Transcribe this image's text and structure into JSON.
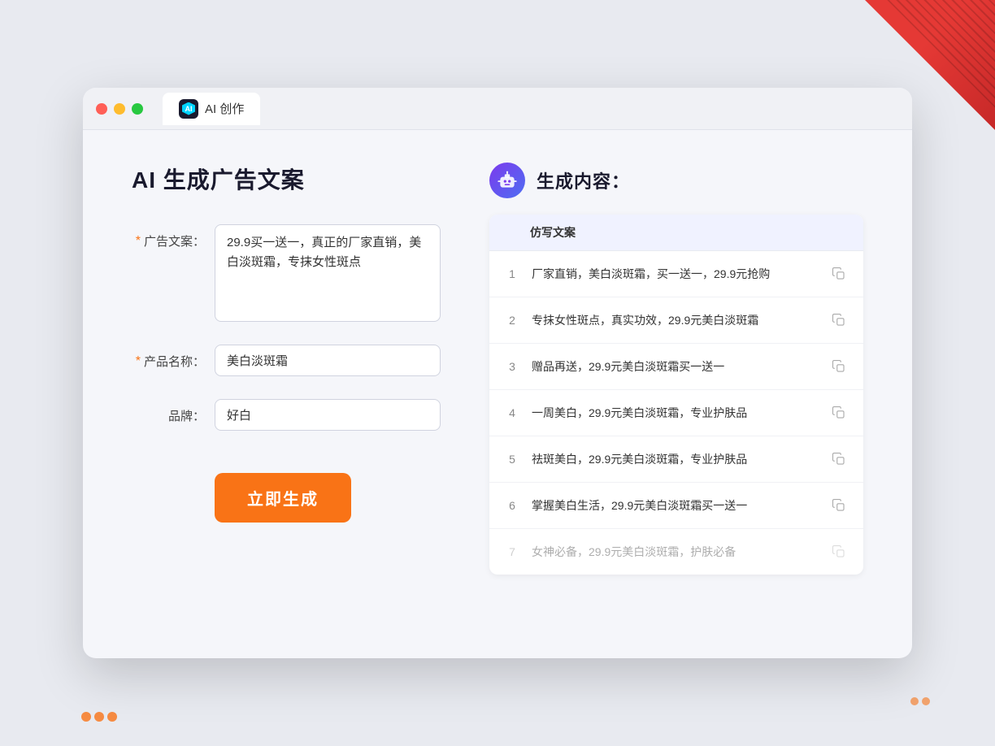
{
  "decorative": {
    "corner_dots": [
      "dot1",
      "dot2",
      "dot3"
    ]
  },
  "titlebar": {
    "tab_label": "AI 创作",
    "tab_icon_text": "AI"
  },
  "page": {
    "title": "AI 生成广告文案",
    "result_section_label": "生成内容："
  },
  "form": {
    "ad_copy_label": "广告文案：",
    "ad_copy_required": "*",
    "ad_copy_value": "29.9买一送一，真正的厂家直销，美白淡斑霜，专抹女性斑点",
    "product_name_label": "产品名称：",
    "product_name_required": "*",
    "product_name_value": "美白淡斑霜",
    "brand_label": "品牌：",
    "brand_value": "好白",
    "generate_button": "立即生成"
  },
  "result": {
    "table_header": "仿写文案",
    "robot_label": "AI机器人",
    "items": [
      {
        "num": 1,
        "text": "厂家直销，美白淡斑霜，买一送一，29.9元抢购",
        "faded": false
      },
      {
        "num": 2,
        "text": "专抹女性斑点，真实功效，29.9元美白淡斑霜",
        "faded": false
      },
      {
        "num": 3,
        "text": "赠品再送，29.9元美白淡斑霜买一送一",
        "faded": false
      },
      {
        "num": 4,
        "text": "一周美白，29.9元美白淡斑霜，专业护肤品",
        "faded": false
      },
      {
        "num": 5,
        "text": "祛斑美白，29.9元美白淡斑霜，专业护肤品",
        "faded": false
      },
      {
        "num": 6,
        "text": "掌握美白生活，29.9元美白淡斑霜买一送一",
        "faded": false
      },
      {
        "num": 7,
        "text": "女神必备，29.9元美白淡斑霜，护肤必备",
        "faded": true
      }
    ]
  }
}
